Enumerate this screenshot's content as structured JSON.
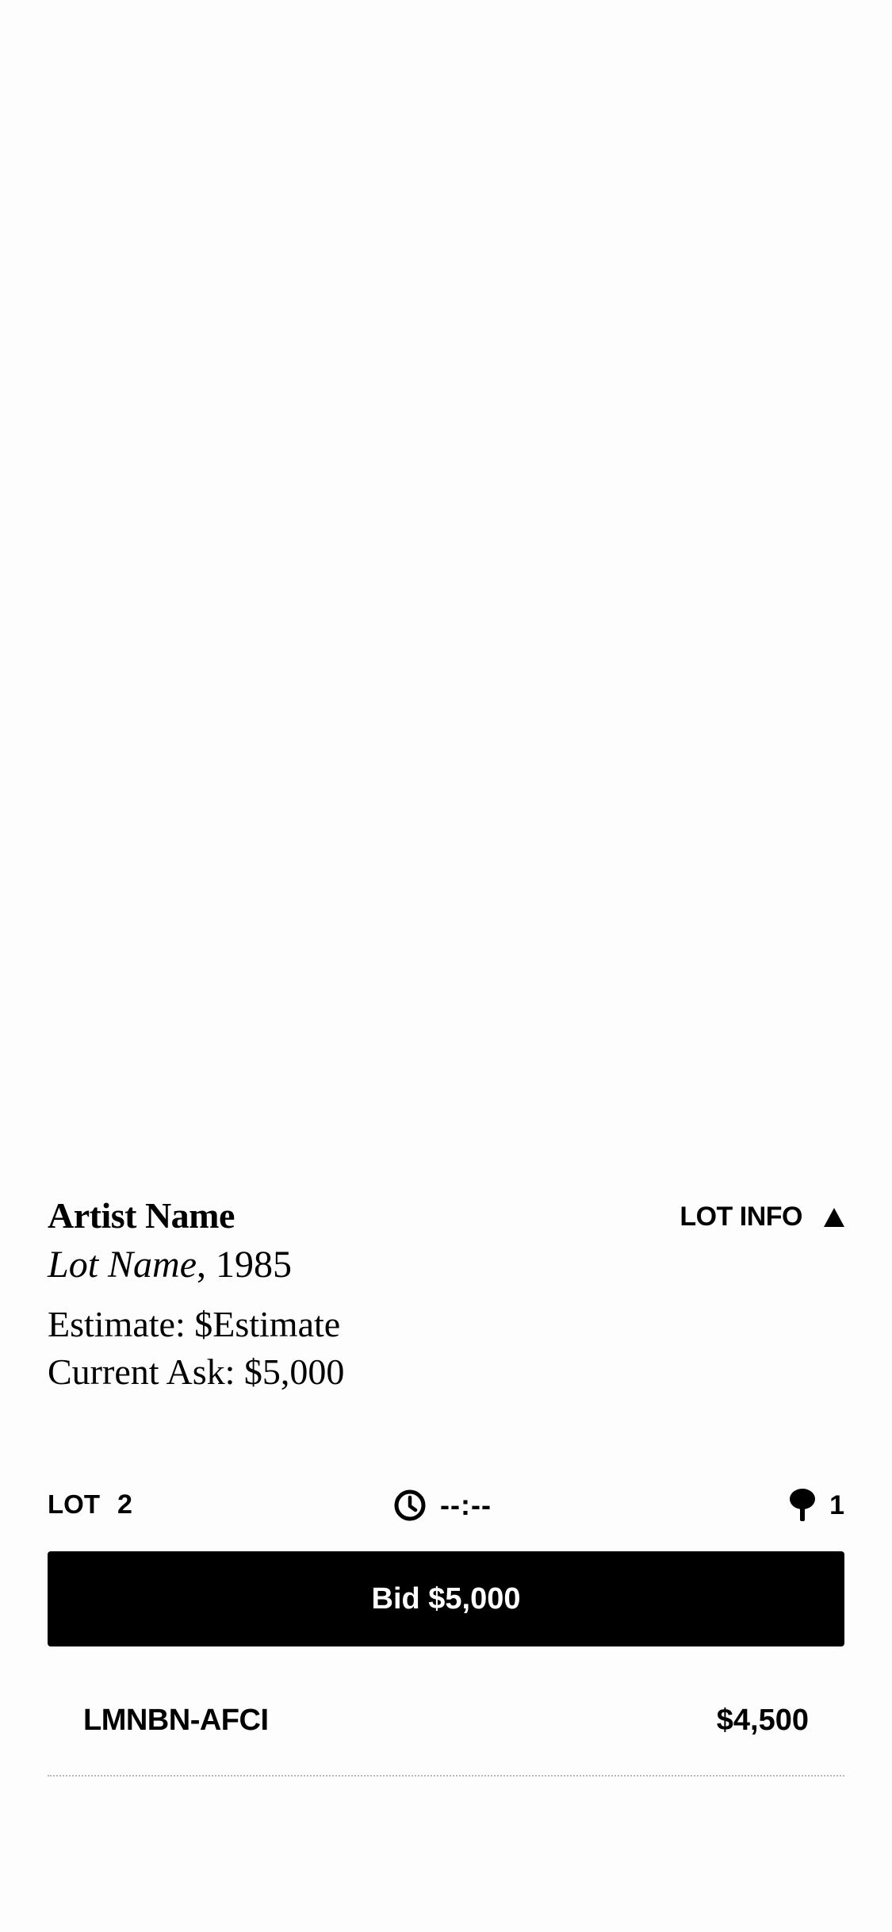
{
  "lot": {
    "artist_name": "Artist Name",
    "lot_name": "Lot Name",
    "year_suffix": ", 1985",
    "estimate": "Estimate: $Estimate",
    "current_ask": "Current Ask: $5,000",
    "lot_info_label": "LOT INFO",
    "lot_info_icon": "triangle-up-icon"
  },
  "status": {
    "lot_label": "LOT",
    "lot_number": "2",
    "timer_icon": "clock-icon",
    "timer_value": "--:--",
    "paddle_icon": "paddle-icon",
    "paddle_count": "1"
  },
  "bid_button_label": "Bid $5,000",
  "bids": [
    {
      "bidder": "LMNBN-AFCI",
      "amount": "$4,500"
    }
  ],
  "colors": {
    "background": "#fdfdfd",
    "text": "#000000",
    "button_bg": "#000000",
    "button_text": "#ffffff",
    "divider": "#b8b8b8"
  }
}
